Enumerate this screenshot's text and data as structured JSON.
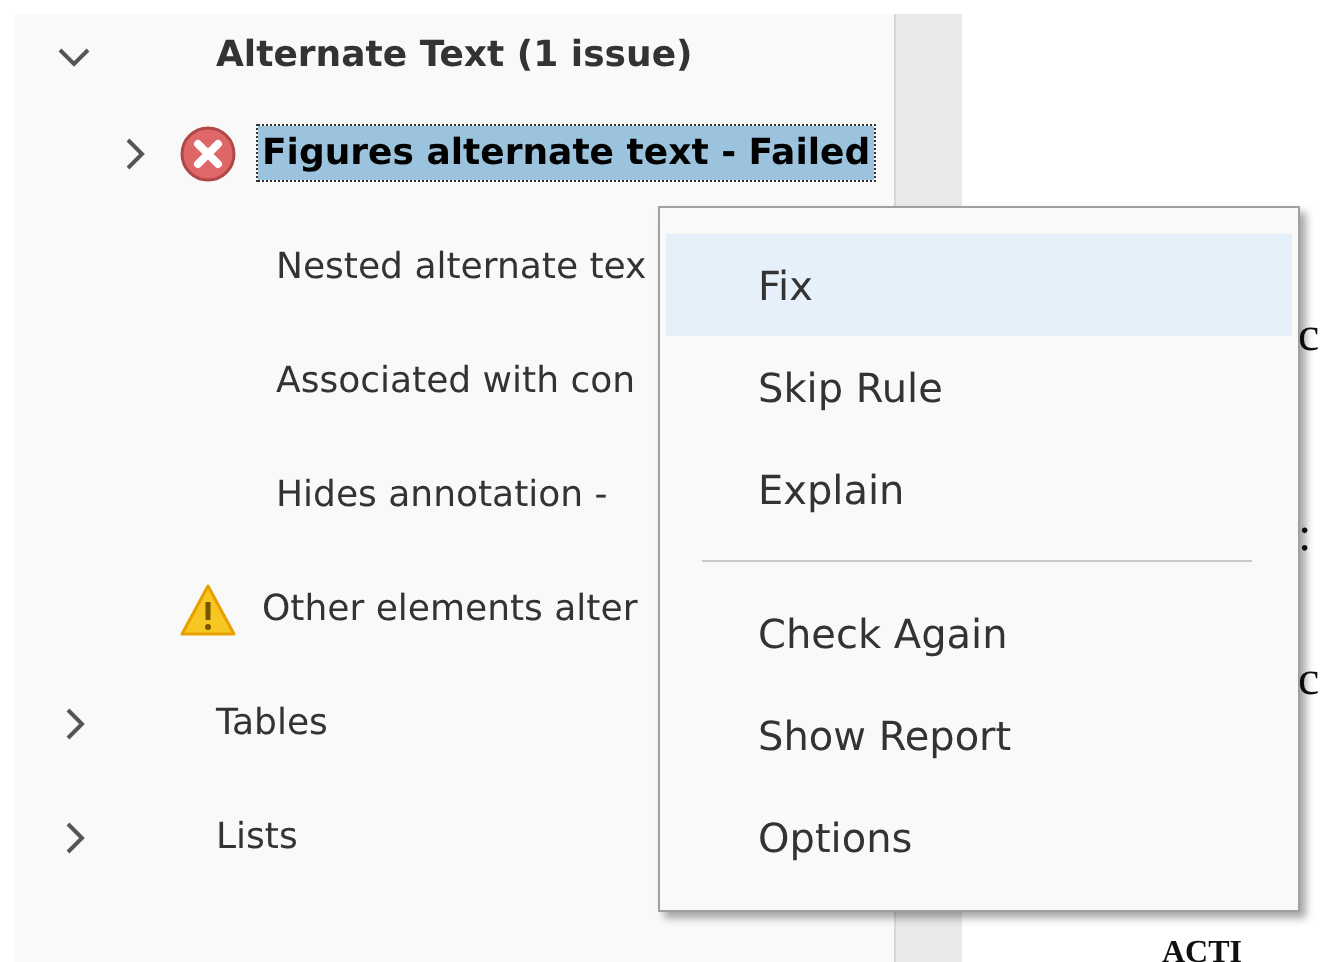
{
  "tree": [
    {
      "label": "Alternate Text (1 issue)",
      "expanded": true,
      "selected": false,
      "children": [
        {
          "label": "Figures alternate text - Failed",
          "kind": "failed",
          "selected": true,
          "expanded": false
        },
        {
          "label": "Nested alternate tex",
          "kind": "passed",
          "selected": false
        },
        {
          "label": "Associated with con",
          "kind": "passed",
          "selected": false
        },
        {
          "label": "Hides annotation -",
          "kind": "passed",
          "selected": false
        },
        {
          "label": "Other elements alter",
          "kind": "warning",
          "selected": false
        }
      ]
    },
    {
      "label": "Tables",
      "expanded": false,
      "selected": false
    },
    {
      "label": "Lists",
      "expanded": false,
      "selected": false
    }
  ],
  "context_menu": {
    "items": [
      {
        "kind": "item",
        "label": "Fix",
        "highlighted": true
      },
      {
        "kind": "item",
        "label": "Skip Rule",
        "highlighted": false
      },
      {
        "kind": "item",
        "label": "Explain",
        "highlighted": false
      },
      {
        "kind": "separator"
      },
      {
        "kind": "item",
        "label": "Check Again",
        "highlighted": false
      },
      {
        "kind": "item",
        "label": "Show Report",
        "highlighted": false
      },
      {
        "kind": "item",
        "label": "Options",
        "highlighted": false
      }
    ]
  },
  "document": {
    "fragments": [
      "c",
      ":",
      "c",
      "ACTI"
    ]
  }
}
